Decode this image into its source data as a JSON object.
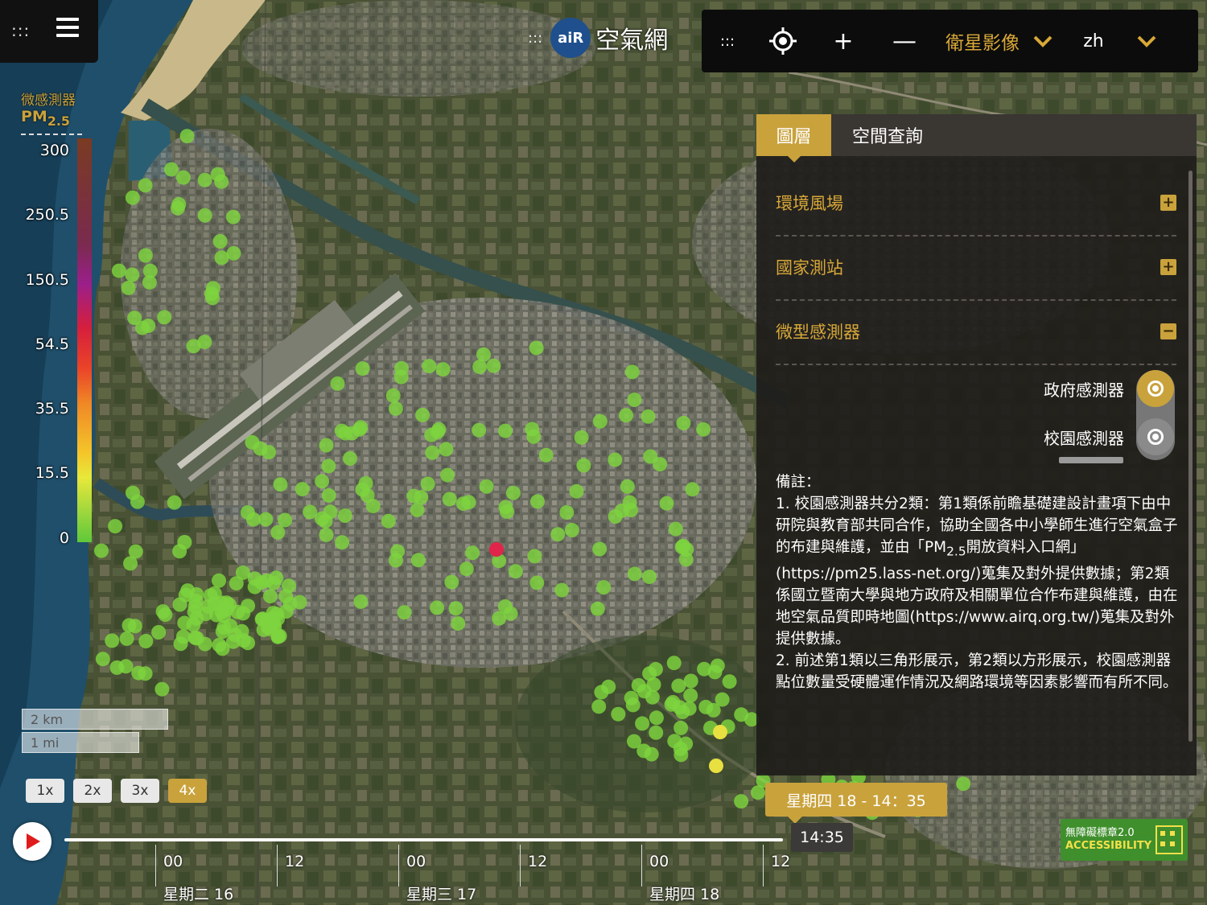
{
  "header": {
    "logo_text": "aiR",
    "app_name": "空氣網",
    "menu_dots": ":::",
    "logo_dots": ":::"
  },
  "toolbar": {
    "dots": ":::",
    "locate_icon": "crosshair-icon",
    "zoom_in": "+",
    "zoom_out": "—",
    "layer_select": "衛星影像",
    "language_select": "zh"
  },
  "legend": {
    "title": "微感測器",
    "pm_label": "PM",
    "pm_sub": "2.5",
    "ticks": [
      "300",
      "250.5",
      "150.5",
      "54.5",
      "35.5",
      "15.5",
      "0"
    ]
  },
  "panel": {
    "tabs": [
      {
        "label": "圖層",
        "active": true
      },
      {
        "label": "空間查詢",
        "active": false
      }
    ],
    "sections": [
      {
        "label": "環境風場",
        "state": "+"
      },
      {
        "label": "國家測站",
        "state": "+"
      },
      {
        "label": "微型感測器",
        "state": "−"
      }
    ],
    "sensors": [
      {
        "label": "政府感測器",
        "enabled": true
      },
      {
        "label": "校園感測器",
        "enabled": false
      }
    ],
    "note_title": "備註：",
    "note_1a": "1. 校園感測器共分2類：第1類係前瞻基礎建設計畫項下由中研院與教育部共同合作，協助全國各中小學師生進行空氣盒子的布建與維護，並由「PM",
    "note_1_sub": "2.5",
    "note_1b": "開放資料入口網」(https://pm25.lass-net.org/)蒐集及對外提供數據；第2類係國立暨南大學與地方政府及相關單位合作布建與維護，由在地空氣品質即時地圖(https://www.airq.org.tw/)蒐集及對外提供數據。",
    "note_2": "2. 前述第1類以三角形展示，第2類以方形展示，校園感測器點位數量受硬體運作情況及網路環境等因素影響而有所不同。"
  },
  "scale": {
    "km": "2 km",
    "mi": "1 mi"
  },
  "speeds": [
    {
      "label": "1x",
      "active": false
    },
    {
      "label": "2x",
      "active": false
    },
    {
      "label": "3x",
      "active": false
    },
    {
      "label": "4x",
      "active": true
    }
  ],
  "timeline": {
    "current_date": "星期四 18 - 14：35",
    "current_time": "14:35",
    "hour_labels": [
      "00",
      "12",
      "00",
      "12",
      "00",
      "12"
    ],
    "day_labels": [
      "星期二 16",
      "星期三 17",
      "星期四 18"
    ]
  },
  "accessibility_badge": {
    "line1": "無障礙標章2.0",
    "line2": "ACCESSIBILITY"
  },
  "colors": {
    "accent": "#c9a23c",
    "sensor_good": "#7ed43e",
    "sensor_moderate": "#e8e040",
    "sensor_high": "#e0244a"
  }
}
